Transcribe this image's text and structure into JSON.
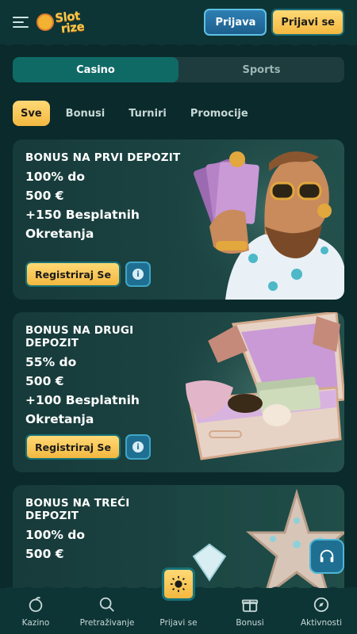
{
  "header": {
    "logo_line1": "Slot",
    "logo_line2": "rize",
    "login_label": "Prijava",
    "signup_label": "Prijavi se"
  },
  "tabs": [
    {
      "label": "Casino",
      "active": true
    },
    {
      "label": "Sports",
      "active": false
    }
  ],
  "filters": [
    {
      "label": "Sve",
      "active": true
    },
    {
      "label": "Bonusi",
      "active": false
    },
    {
      "label": "Turniri",
      "active": false
    },
    {
      "label": "Promocije",
      "active": false
    }
  ],
  "cards": [
    {
      "title": "BONUS NA PRVI DEPOZIT",
      "line1": "100% do",
      "line2": "500 €",
      "line3": "+150 Besplatnih",
      "line4": "Okretanja",
      "button": "Registriraj Se"
    },
    {
      "title": "BONUS NA DRUGI DEPOZIT",
      "line1": "55% do",
      "line2": "500 €",
      "line3": "+100 Besplatnih",
      "line4": "Okretanja",
      "button": "Registriraj Se"
    },
    {
      "title": "BONUS NA TREĆI DEPOZIT",
      "line1": "100% do",
      "line2": "500 €"
    }
  ],
  "bottom_nav": [
    {
      "label": "Kazino",
      "icon": "casino-icon"
    },
    {
      "label": "Pretraživanje",
      "icon": "search-icon"
    },
    {
      "label": "Prijavi se",
      "icon": "sun-icon"
    },
    {
      "label": "Bonusi",
      "icon": "gift-icon"
    },
    {
      "label": "Aktivnosti",
      "icon": "compass-icon"
    }
  ],
  "colors": {
    "background": "#0b2a2b",
    "accent_gold": "#f3b840",
    "accent_teal": "#0f6a66",
    "accent_blue": "#1f6f93"
  }
}
